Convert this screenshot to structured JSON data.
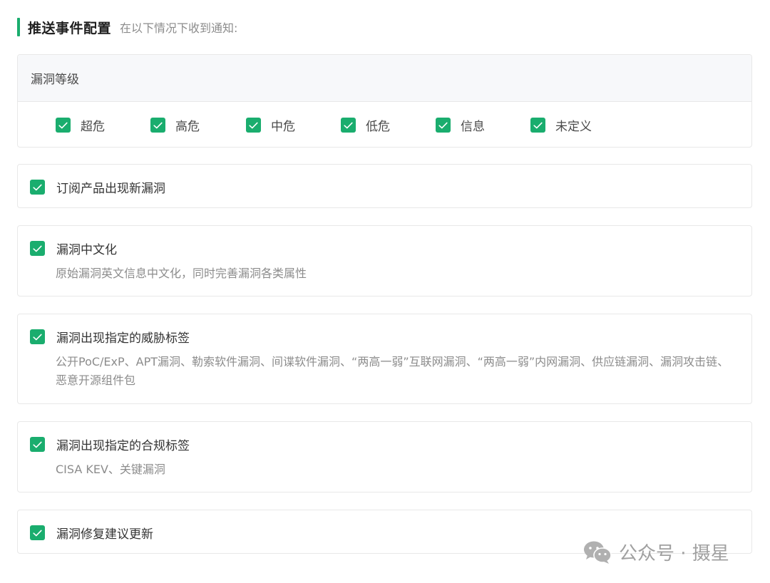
{
  "header": {
    "title": "推送事件配置",
    "subtitle": "在以下情况下收到通知:"
  },
  "levels": {
    "title": "漏洞等级",
    "items": [
      {
        "label": "超危",
        "checked": true
      },
      {
        "label": "高危",
        "checked": true
      },
      {
        "label": "中危",
        "checked": true
      },
      {
        "label": "低危",
        "checked": true
      },
      {
        "label": "信息",
        "checked": true
      },
      {
        "label": "未定义",
        "checked": true
      }
    ]
  },
  "options": [
    {
      "title": "订阅产品出现新漏洞",
      "checked": true
    },
    {
      "title": "漏洞中文化",
      "desc": "原始漏洞英文信息中文化，同时完善漏洞各类属性",
      "checked": true
    },
    {
      "title": "漏洞出现指定的威胁标签",
      "desc": "公开PoC/ExP、APT漏洞、勒索软件漏洞、间谍软件漏洞、“两高一弱”互联网漏洞、“两高一弱”内网漏洞、供应链漏洞、漏洞攻击链、恶意开源组件包",
      "checked": true
    },
    {
      "title": "漏洞出现指定的合规标签",
      "desc": "CISA KEV、关键漏洞",
      "checked": true
    },
    {
      "title": "漏洞修复建议更新",
      "checked": true
    }
  ],
  "watermark": {
    "text": "公众号 · 摄星",
    "icon": "wechat-icon"
  },
  "colors": {
    "accent": "#1aad6e"
  }
}
